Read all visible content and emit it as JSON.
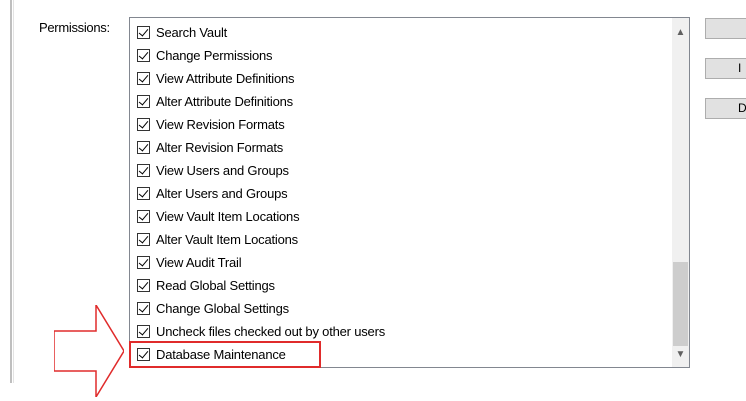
{
  "permissions_label": "Permissions:",
  "items": [
    {
      "label": "Search Vault",
      "checked": true
    },
    {
      "label": "Change Permissions",
      "checked": true
    },
    {
      "label": "View Attribute Definitions",
      "checked": true
    },
    {
      "label": "Alter Attribute Definitions",
      "checked": true
    },
    {
      "label": "View Revision Formats",
      "checked": true
    },
    {
      "label": "Alter Revision Formats",
      "checked": true
    },
    {
      "label": "View Users and Groups",
      "checked": true
    },
    {
      "label": "Alter Users and Groups",
      "checked": true
    },
    {
      "label": "View Vault Item Locations",
      "checked": true
    },
    {
      "label": "Alter Vault Item Locations",
      "checked": true
    },
    {
      "label": "View Audit Trail",
      "checked": true
    },
    {
      "label": "Read Global Settings",
      "checked": true
    },
    {
      "label": "Change Global Settings",
      "checked": true
    },
    {
      "label": "Uncheck files checked out by other users",
      "checked": true
    },
    {
      "label": "Database Maintenance",
      "checked": true
    }
  ],
  "highlighted_item": "Database Maintenance",
  "highlight_color": "#e02b2b",
  "side_buttons": [
    "",
    "I",
    "D"
  ],
  "icons": {
    "scroll_up": "chevron-up-icon",
    "scroll_down": "chevron-down-icon",
    "pointer": "arrow-right-icon"
  }
}
